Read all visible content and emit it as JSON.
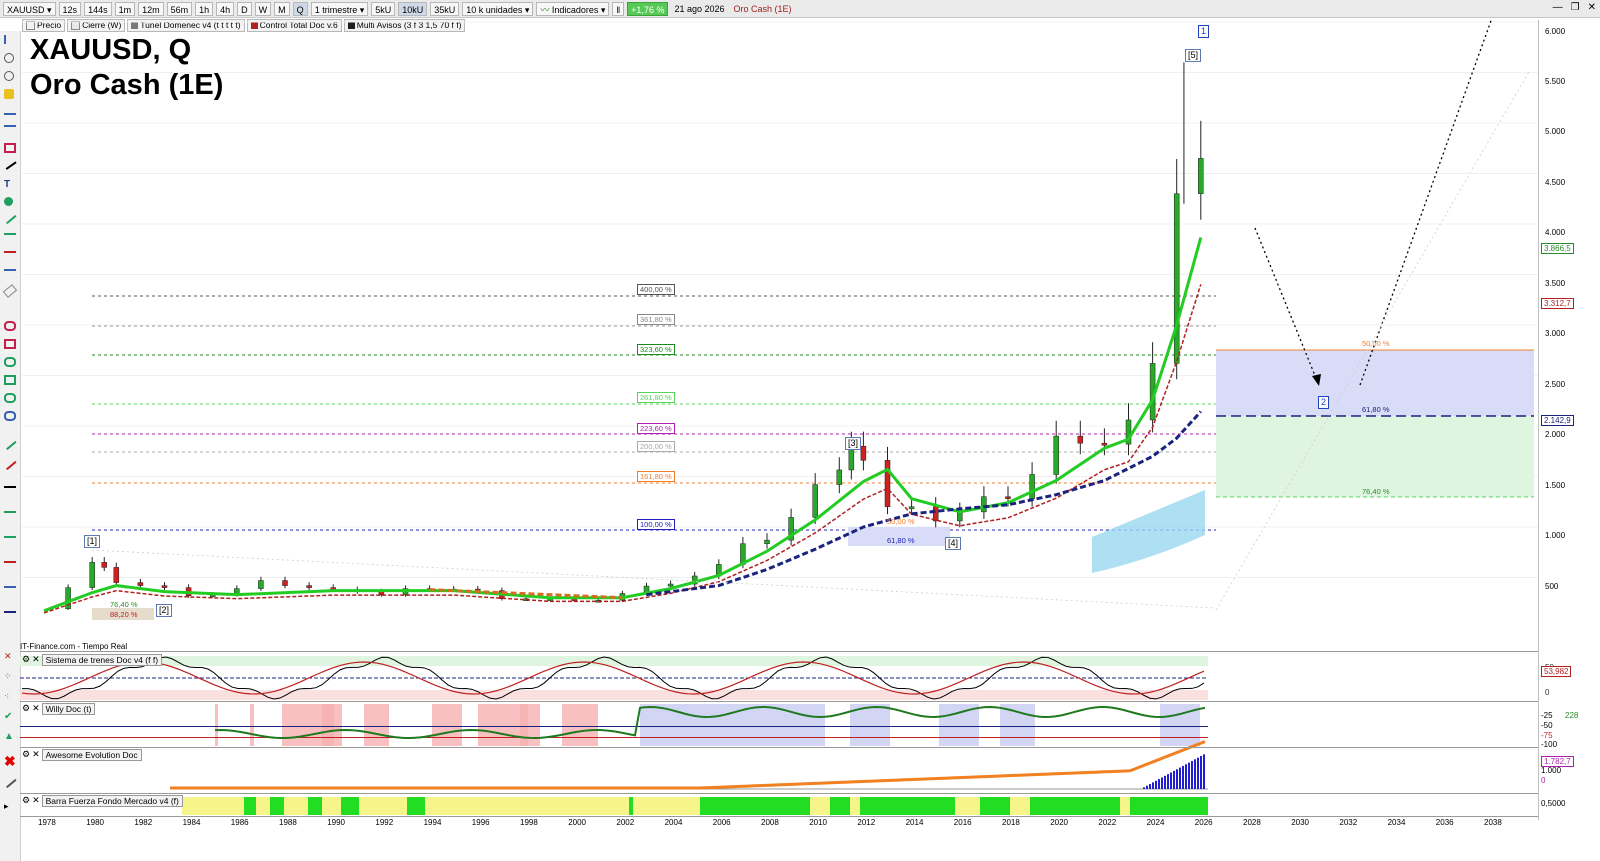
{
  "toolbar": {
    "symbol": "XAUUSD",
    "tf_buttons": [
      "12s",
      "144s",
      "1m",
      "12m",
      "56m",
      "1h",
      "4h",
      "D",
      "W",
      "M",
      "Q"
    ],
    "period": "1 trimestre",
    "volume_buttons": [
      "5kU",
      "10kU",
      "35kU"
    ],
    "units": "10 k unidades",
    "indicators": "Indicadores",
    "change": "+1,76 %",
    "date": "21 ago 2026",
    "instrument_name": "Oro Cash (1E)"
  },
  "indicator_bar": {
    "price_label": "Precio",
    "items": [
      {
        "label": "Cierre (W)",
        "color": "#e8e8e8"
      },
      {
        "label": "Tunel Domenec v4 (t t t t t)",
        "color": "#7a7a7a"
      },
      {
        "label": "Control Total Doc v.6",
        "color": "#b02020"
      },
      {
        "label": "Multi Avisos (3 f 3 1,5 70 f f)",
        "color": "#202020"
      }
    ]
  },
  "chart_title": {
    "line1": "XAUUSD, Q",
    "line2": "Oro Cash (1E)"
  },
  "y_axis": {
    "labels": [
      "6.000",
      "5.500",
      "5.000",
      "4.500",
      "4.000",
      "3.500",
      "3.000",
      "2.500",
      "2.000",
      "1.500",
      "1.000",
      "500"
    ],
    "price_tags": [
      {
        "label": "3.866,5",
        "color": "#2a8a2a"
      },
      {
        "label": "3.312,7",
        "color": "#b02020"
      },
      {
        "label": "2.142,9",
        "color": "#1a237e"
      }
    ]
  },
  "x_axis": {
    "labels": [
      "1978",
      "1980",
      "1982",
      "1984",
      "1986",
      "1988",
      "1990",
      "1992",
      "1994",
      "1996",
      "1998",
      "2000",
      "2002",
      "2004",
      "2006",
      "2008",
      "2010",
      "2012",
      "2014",
      "2016",
      "2018",
      "2020",
      "2022",
      "2024",
      "2026",
      "2028",
      "2030",
      "2032",
      "2034",
      "2036",
      "2038"
    ]
  },
  "fib_levels": [
    {
      "label": "400,00 %",
      "color": "#555555"
    },
    {
      "label": "361,80 %",
      "color": "#888888"
    },
    {
      "label": "323,60 %",
      "color": "#1b8a1b"
    },
    {
      "label": "261,80 %",
      "color": "#59d359"
    },
    {
      "label": "223,60 %",
      "color": "#b020b0"
    },
    {
      "label": "200,00 %",
      "color": "#aaaaaa"
    },
    {
      "label": "161,80 %",
      "color": "#f08030"
    },
    {
      "label": "100,00 %",
      "color": "#2020c0"
    }
  ],
  "retracement": {
    "labels": [
      "50,00 %",
      "61,80 %",
      "76,40 %"
    ]
  },
  "small_fib": {
    "labels": [
      "76,40 %",
      "88,20 %",
      "50,00 %",
      "61,80 %"
    ]
  },
  "waves": [
    "[1]",
    "[2]",
    "[3]",
    "[4]",
    "[5]",
    "1",
    "2"
  ],
  "footer": "IT-Finance.com - Tiempo Real",
  "subpanels": [
    {
      "label": "Sistema de trenes Doc v4 (f f)",
      "values": [
        "53,982",
        "50",
        "0"
      ]
    },
    {
      "label": "Willy Doc (t)",
      "values": [
        "-25",
        "228",
        "-50",
        "-75",
        "-100"
      ]
    },
    {
      "label": "Awesome Evolution Doc",
      "values": [
        "1.782,7",
        "1.000",
        "0"
      ]
    },
    {
      "label": "Barra Fuerza Fondo Mercado v4 (f)",
      "values": [
        "0,5000"
      ]
    }
  ],
  "colors": {
    "accent_green": "#22cc22",
    "ma_navy": "#1a237e",
    "red_dashed": "#b02020",
    "fill_blue": "#9ad7f0",
    "retr_top": "#d9dcf6",
    "retr_bottom": "#dff5df"
  }
}
